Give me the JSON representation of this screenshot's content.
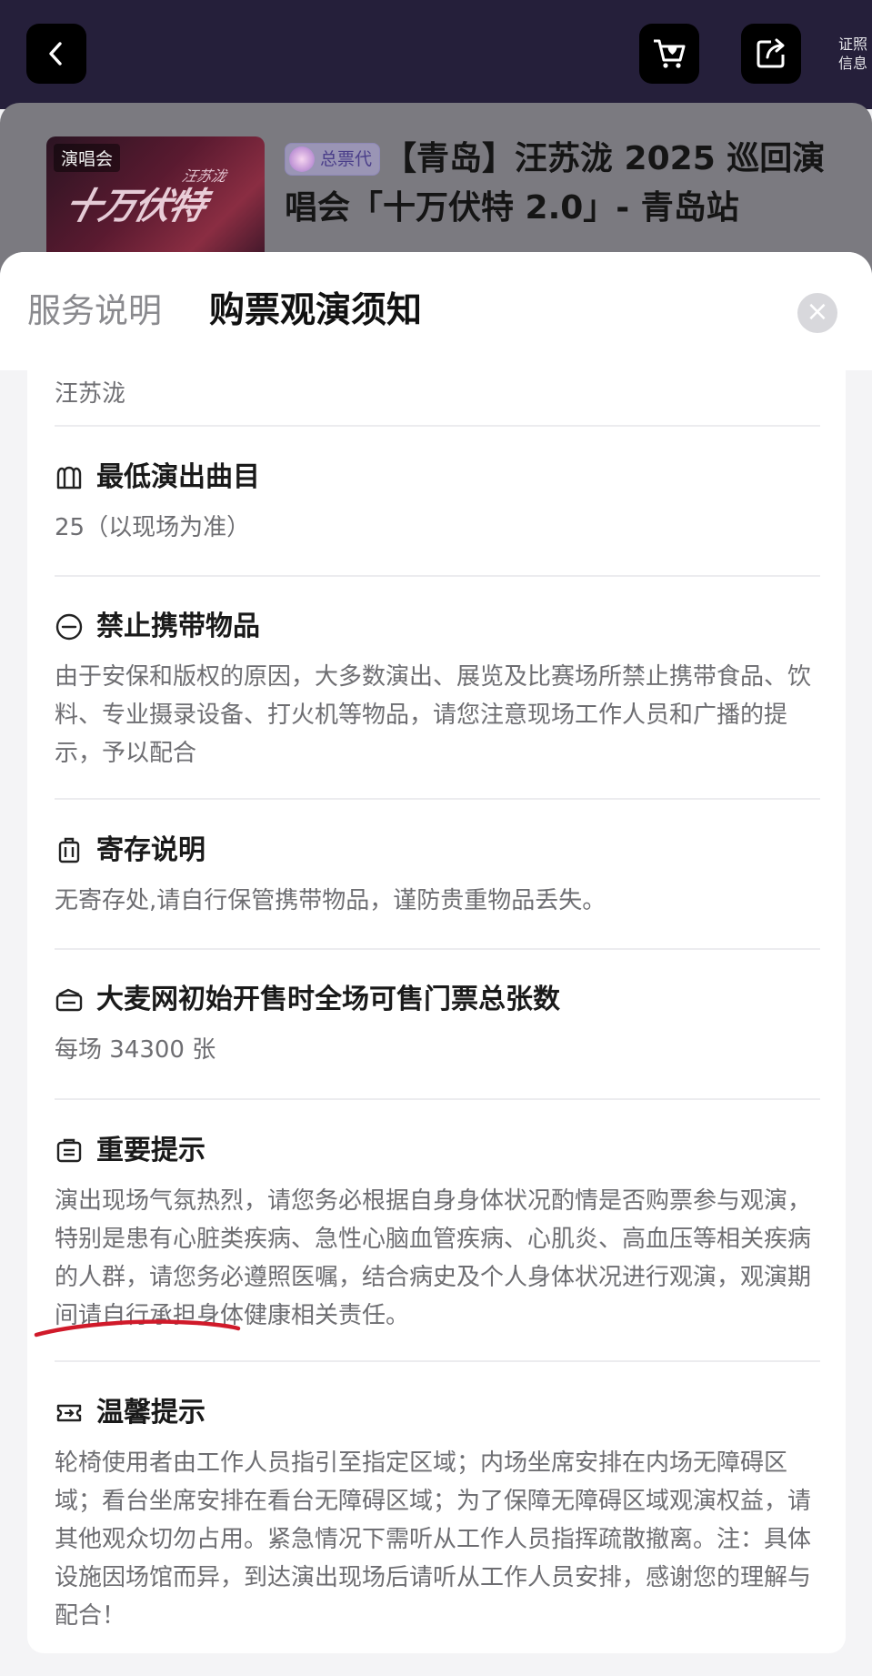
{
  "header": {
    "cert_info_line1": "证照",
    "cert_info_line2": "信息"
  },
  "event": {
    "poster_tag": "演唱会",
    "poster_art_text": "十万伏特",
    "poster_art_sub": "汪苏泷",
    "agent_badge": "总票代",
    "title": "【青岛】汪苏泷 2025 巡回演唱会「十万伏特 2.0」- 青岛站"
  },
  "sheet": {
    "tabs": [
      "服务说明",
      "购票观演须知"
    ],
    "close_icon": "×",
    "partial_text": "汪苏泷"
  },
  "sections": [
    {
      "icon": "setlist-icon",
      "title": "最低演出曲目",
      "body": "25（以现场为准）"
    },
    {
      "icon": "prohibited-icon",
      "title": "禁止携带物品",
      "body": "由于安保和版权的原因，大多数演出、展览及比赛场所禁止携带食品、饮料、专业摄录设备、打火机等物品，请您注意现场工作人员和广播的提示，予以配合"
    },
    {
      "icon": "luggage-icon",
      "title": "寄存说明",
      "body": "无寄存处,请自行保管携带物品，谨防贵重物品丢失。"
    },
    {
      "icon": "ticket-count-icon",
      "title": "大麦网初始开售时全场可售门票总张数",
      "body": "每场 34300 张"
    },
    {
      "icon": "notice-icon",
      "title": "重要提示",
      "body": "演出现场气氛热烈，请您务必根据自身身体状况酌情是否购票参与观演，特别是患有心脏类疾病、急性心脑血管疾病、心肌炎、高血压等相关疾病的人群，请您务必遵照医嘱，结合病史及个人身体状况进行观演，观演期间请自行承担身体健康相关责任。"
    },
    {
      "icon": "entry-icon",
      "title": "温馨提示",
      "body": "轮椅使用者由工作人员指引至指定区域；内场坐席安排在内场无障碍区域；看台坐席安排在看台无障碍区域；为了保障无障碍区域观演权益，请其他观众切勿占用。紧急情况下需听从工作人员指挥疏散撤离。注：具体设施因场馆而异，到达演出现场后请听从工作人员安排，感谢您的理解与配合！"
    }
  ],
  "colors": {
    "top_bar": "#251f3a",
    "highlight_underline": "#d01a2a"
  }
}
